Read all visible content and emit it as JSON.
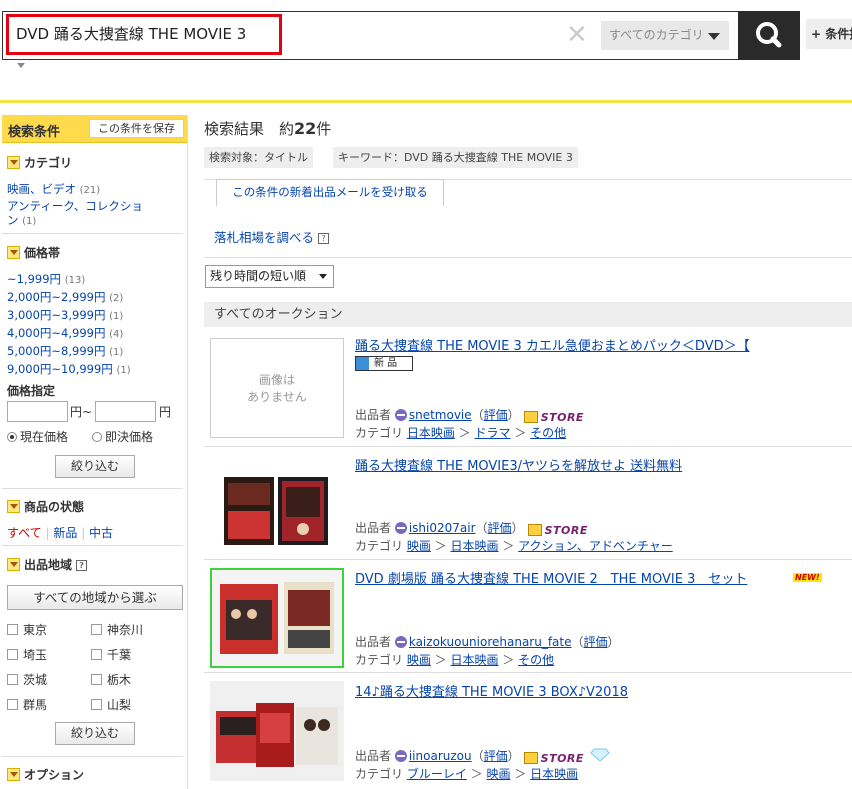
{
  "search": {
    "query": "DVD 踊る大捜査線 THE MOVIE 3",
    "category": "すべてのカテゴリ",
    "clear_label": "✕",
    "cond_button": "+ 条件指定"
  },
  "sidebar": {
    "title": "検索条件",
    "save_label": "この条件を保存",
    "category_title": "カテゴリ",
    "categories": [
      {
        "label": "映画、ビデオ",
        "count": "(21)"
      },
      {
        "label": "アンティーク、コレクショ",
        "label2": "ン",
        "count": "(1)"
      }
    ],
    "price_title": "価格帯",
    "prices": [
      {
        "label": "~1,999円",
        "count": "(13)"
      },
      {
        "label": "2,000円~2,999円",
        "count": "(2)"
      },
      {
        "label": "3,000円~3,999円",
        "count": "(1)"
      },
      {
        "label": "4,000円~4,999円",
        "count": "(4)"
      },
      {
        "label": "5,000円~8,999円",
        "count": "(1)"
      },
      {
        "label": "9,000円~10,999円",
        "count": "(1)"
      }
    ],
    "price_spec_title": "価格指定",
    "yen_from": "円~",
    "yen_to": "円",
    "radio_current": "現在価格",
    "radio_buynow": "即決価格",
    "filter_label": "絞り込む",
    "condition_title": "商品の状態",
    "cond_all": "すべて",
    "cond_new": "新品",
    "cond_used": "中古",
    "region_title": "出品地域",
    "region_all_button": "すべての地域から選ぶ",
    "regions": [
      "東京",
      "神奈川",
      "埼玉",
      "千葉",
      "茨城",
      "栃木",
      "群馬",
      "山梨"
    ],
    "filter_label2": "絞り込む",
    "option_title": "オプション"
  },
  "main": {
    "results_label": "検索結果　約",
    "results_count": "22",
    "results_unit": "件",
    "tag_target": "検索対象：タイトル",
    "tag_keyword": "キーワード：DVD 踊る大捜査線 THE MOVIE 3",
    "mail_tab": "この条件の新着出品メールを受け取る",
    "market_link": "落札相場を調べる",
    "sort_label": "残り時間の短い順",
    "all_auctions": "すべてのオークション",
    "no_image": "画像は\nありません",
    "seller_label": "出品者",
    "category_label": "カテゴリ",
    "rating_label": "評価",
    "new_badge": "新 品",
    "new_flag": "NEW!",
    "store_label": "STORE",
    "items": [
      {
        "title": "踊る大捜査線 THE MOVIE 3 カエル急便おまとめパック＜DVD＞【",
        "seller": "snetmovie",
        "categories": [
          "日本映画",
          "ドラマ",
          "その他"
        ]
      },
      {
        "title": "踊る大捜査線 THE MOVIE3/ヤツらを解放せよ 送料無料",
        "seller": "ishi0207air",
        "categories": [
          "映画",
          "日本映画",
          "アクション、アドベンチャー"
        ]
      },
      {
        "title": "DVD 劇場版 踊る大捜査線 THE MOVIE 2　THE MOVIE 3　セット",
        "seller": "kaizokuouniorehanaru_fate",
        "categories": [
          "映画",
          "日本映画",
          "その他"
        ]
      },
      {
        "title": "14♪踊る大捜査線 THE MOVIE 3 BOX♪V2018",
        "seller": "iinoaruzou",
        "categories": [
          "ブルーレイ",
          "映画",
          "日本映画"
        ]
      }
    ]
  }
}
